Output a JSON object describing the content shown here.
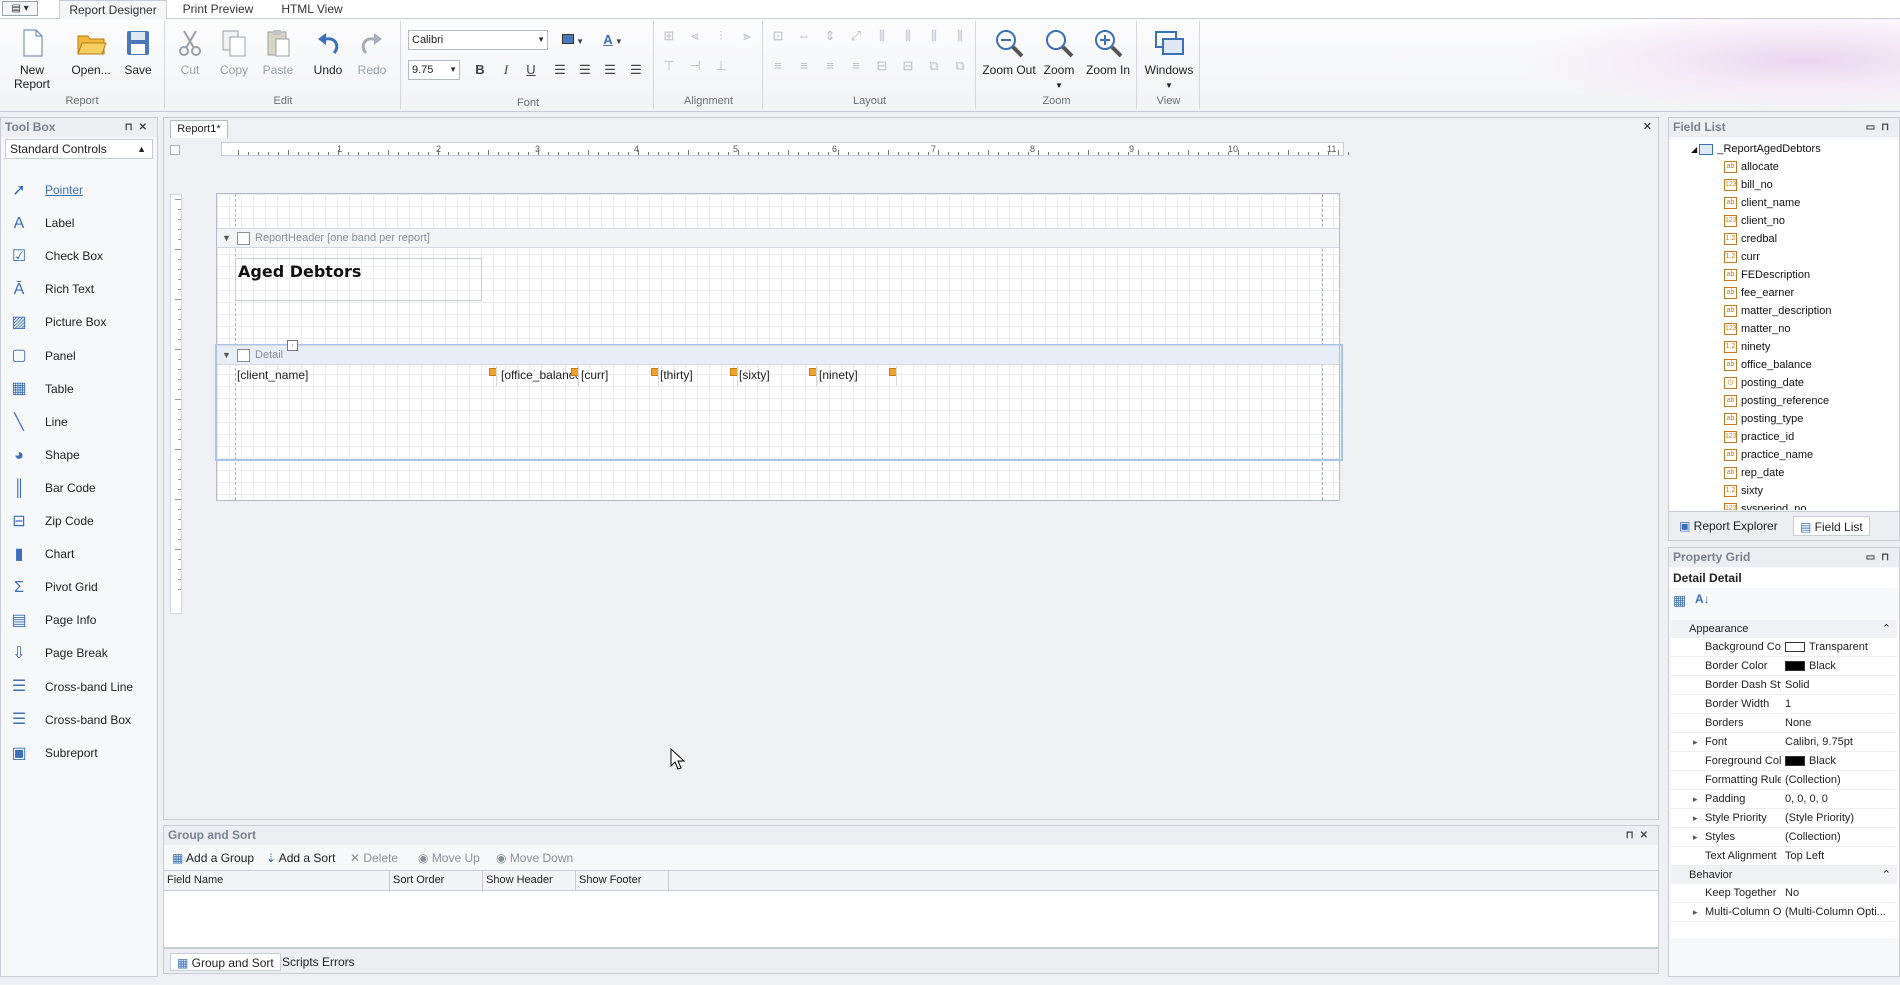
{
  "tabs": {
    "active": "Report Designer",
    "print_preview": "Print Preview",
    "html_view": "HTML View"
  },
  "ribbon": {
    "report_group": "Report",
    "new_report": "New Report",
    "open": "Open...",
    "save": "Save",
    "edit_group": "Edit",
    "cut": "Cut",
    "copy": "Copy",
    "paste": "Paste",
    "undo": "Undo",
    "redo": "Redo",
    "font_group": "Font",
    "font_name": "Calibri",
    "font_size": "9.75",
    "alignment_group": "Alignment",
    "layout_group": "Layout",
    "zoom_group": "Zoom",
    "zoom_out": "Zoom Out",
    "zoom": "Zoom",
    "zoom_in": "Zoom In",
    "view_group": "View",
    "windows": "Windows"
  },
  "toolbox": {
    "title": "Tool Box",
    "category": "Standard Controls",
    "items": [
      "Pointer",
      "Label",
      "Check Box",
      "Rich Text",
      "Picture Box",
      "Panel",
      "Table",
      "Line",
      "Shape",
      "Bar Code",
      "Zip Code",
      "Chart",
      "Pivot Grid",
      "Page Info",
      "Page Break",
      "Cross-band Line",
      "Cross-band Box",
      "Subreport"
    ]
  },
  "designer": {
    "doc_tab": "Report1*",
    "ruler": [
      "1",
      "2",
      "3",
      "4",
      "5",
      "6",
      "7",
      "8",
      "9",
      "10",
      "11"
    ],
    "report_header_band": "ReportHeader [one band per report]",
    "report_title": "Aged Debtors",
    "detail_band": "Detail",
    "fields": [
      "[client_name]",
      "[office_balance]",
      "[curr]",
      "[thirty]",
      "[sixty]",
      "[ninety]"
    ]
  },
  "field_list": {
    "title": "Field List",
    "root": "_ReportAgedDebtors",
    "fields": [
      "allocate",
      "bill_no",
      "client_name",
      "client_no",
      "credbal",
      "curr",
      "FEDescription",
      "fee_earner",
      "matter_description",
      "matter_no",
      "ninety",
      "office_balance",
      "posting_date",
      "posting_reference",
      "posting_type",
      "practice_id",
      "practice_name",
      "rep_date",
      "sixty",
      "sysperiod_no"
    ],
    "tab_explorer": "Report Explorer",
    "tab_fieldlist": "Field List"
  },
  "property_grid": {
    "title": "Property Grid",
    "selected_label": "Detail",
    "selected_name": "Detail",
    "cat_appearance": "Appearance",
    "cat_behavior": "Behavior",
    "appearance": [
      {
        "name": "Background Col",
        "value": "Transparent",
        "swatch": "#ffffff"
      },
      {
        "name": "Border Color",
        "value": "Black",
        "swatch": "#000000"
      },
      {
        "name": "Border Dash Sty",
        "value": "Solid"
      },
      {
        "name": "Border Width",
        "value": "1"
      },
      {
        "name": "Borders",
        "value": "None"
      },
      {
        "name": "Font",
        "value": "Calibri, 9.75pt",
        "expand": true
      },
      {
        "name": "Foreground Col",
        "value": "Black",
        "swatch": "#000000"
      },
      {
        "name": "Formatting Rule",
        "value": "(Collection)"
      },
      {
        "name": "Padding",
        "value": "0, 0, 0, 0",
        "expand": true
      },
      {
        "name": "Style Priority",
        "value": "(Style Priority)",
        "expand": true
      },
      {
        "name": "Styles",
        "value": "(Collection)",
        "expand": true
      },
      {
        "name": "Text Alignment",
        "value": "Top Left"
      }
    ],
    "behavior": [
      {
        "name": "Keep Together",
        "value": "No"
      },
      {
        "name": "Multi-Column Op",
        "value": "(Multi-Column Opti...",
        "expand": true
      }
    ]
  },
  "group_sort": {
    "title": "Group and Sort",
    "add_group": "Add a Group",
    "add_sort": "Add a Sort",
    "delete": "Delete",
    "move_up": "Move Up",
    "move_down": "Move Down",
    "columns": [
      "Field Name",
      "Sort Order",
      "Show Header",
      "Show Footer"
    ]
  },
  "bottom_tabs": {
    "group_sort": "Group and Sort",
    "scripts_errors": "Scripts Errors"
  },
  "colors": {
    "accent": "#3b6fb6",
    "handle": "#f2a12b",
    "selection": "#a9c4e8"
  }
}
